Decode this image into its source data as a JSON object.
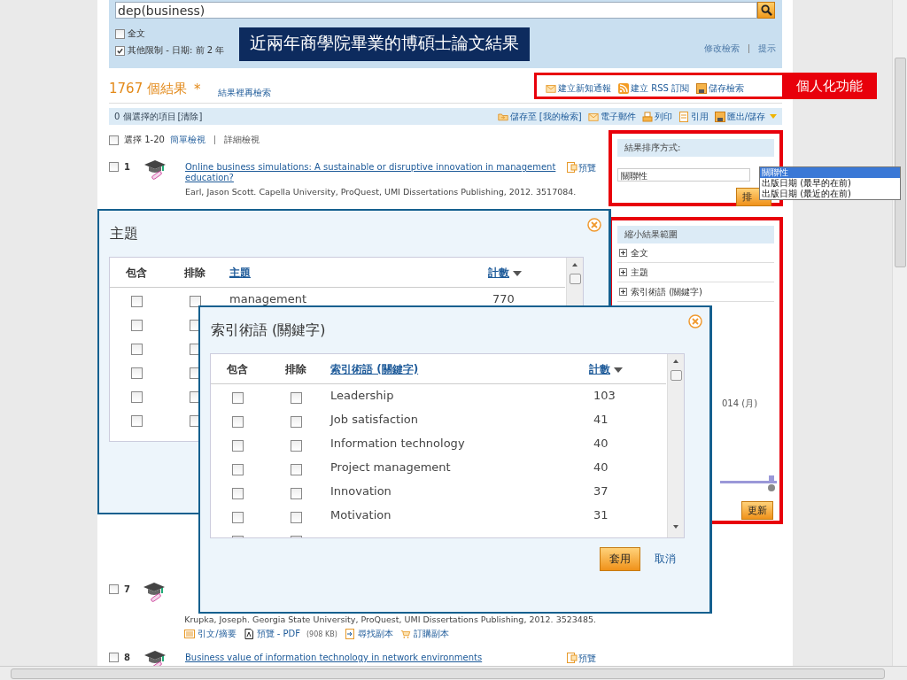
{
  "search": {
    "query": "dep(business)"
  },
  "filters": [
    {
      "label": "全文",
      "checked": false
    },
    {
      "label": "其他限制 - 日期: 前 2 年",
      "checked": true
    }
  ],
  "banner": "近兩年商學院畢業的博碩士論文結果",
  "search_links": [
    "修改檢索",
    "提示"
  ],
  "results_count": "1767 個結果",
  "results_mark": "*",
  "search_within": "結果裡再檢索",
  "personal_actions": [
    {
      "kind": "mail",
      "label": "建立新知通報"
    },
    {
      "kind": "rss",
      "label": "建立 RSS 訂閱"
    },
    {
      "kind": "save",
      "label": "儲存檢索"
    }
  ],
  "personal_label": "個人化功能",
  "selection": {
    "count": "0 個選擇的項目",
    "clear": "[清除]"
  },
  "toolbar": [
    {
      "kind": "folder",
      "label": "儲存至 [我的檢索]"
    },
    {
      "kind": "mail",
      "label": "電子郵件"
    },
    {
      "kind": "print",
      "label": "列印"
    },
    {
      "kind": "cite",
      "label": "引用"
    },
    {
      "kind": "save",
      "label": "匯出/儲存"
    }
  ],
  "view": {
    "select_label": "選擇 1-20",
    "checked": false,
    "views": [
      {
        "label": "簡單檢視",
        "selected": false
      },
      {
        "label": "詳細檢視",
        "selected": true
      }
    ]
  },
  "results": [
    {
      "number": "1",
      "checked": false,
      "title": "Online business simulations: A sustainable or disruptive innovation in management education?",
      "preview": "預覽",
      "meta": "Earl, Jason Scott. Capella University, ProQuest, UMI Dissertations Publishing, 2012. 3517084."
    },
    {
      "number": "7",
      "checked": false,
      "meta": "Krupka, Joseph. Georgia State University, ProQuest, UMI Dissertations Publishing, 2012. 3523485.",
      "actions": [
        {
          "kind": "abstract",
          "label": "引文/摘要"
        },
        {
          "kind": "pdf",
          "label": "預覽 - PDF",
          "size": "(908 KB)"
        },
        {
          "kind": "find",
          "label": "尋找副本"
        },
        {
          "kind": "cart",
          "label": "訂購副本"
        }
      ]
    },
    {
      "number": "8",
      "checked": false,
      "title": "Business value of information technology in network environments",
      "preview": "預覽"
    }
  ],
  "sort": {
    "title": "結果排序方式:",
    "value": "關聯性",
    "button": "排",
    "options": [
      {
        "label": "關聯性",
        "selected": true
      },
      {
        "label": "出版日期 (最早的在前)",
        "selected": false
      },
      {
        "label": "出版日期 (最近的在前)",
        "selected": false
      }
    ]
  },
  "narrow": {
    "title": "縮小結果範圍",
    "facets": [
      {
        "label": "全文",
        "expanded": false
      },
      {
        "label": "主題",
        "expanded": false
      },
      {
        "label": "索引術語 (關鍵字)",
        "expanded": false
      }
    ],
    "date_label": "014 (月)",
    "level": 0.9,
    "update": "更新"
  },
  "modals": [
    {
      "title": "主題",
      "columns": [
        "包含",
        "排除",
        "主題",
        "計數"
      ],
      "rows": [
        {
          "term": "management",
          "count": "770",
          "include": false,
          "exclude": false
        },
        {
          "include": false,
          "exclude": false
        },
        {
          "include": false,
          "exclude": false
        },
        {
          "include": false,
          "exclude": false
        },
        {
          "include": false,
          "exclude": false
        },
        {
          "include": false,
          "exclude": false
        }
      ]
    },
    {
      "title": "索引術語 (關鍵字)",
      "columns": [
        "包含",
        "排除",
        "索引術語 (關鍵字)",
        "計數"
      ],
      "rows": [
        {
          "term": "Leadership",
          "count": "103",
          "include": false,
          "exclude": false
        },
        {
          "term": "Job satisfaction",
          "count": "41",
          "include": false,
          "exclude": false
        },
        {
          "term": "Information technology",
          "count": "40",
          "include": false,
          "exclude": false
        },
        {
          "term": "Project management",
          "count": "40",
          "include": false,
          "exclude": false
        },
        {
          "term": "Innovation",
          "count": "37",
          "include": false,
          "exclude": false
        },
        {
          "term": "Motivation",
          "count": "31",
          "include": false,
          "exclude": false
        },
        {
          "include": false,
          "exclude": false
        }
      ],
      "apply": "套用",
      "cancel": "取消"
    }
  ]
}
